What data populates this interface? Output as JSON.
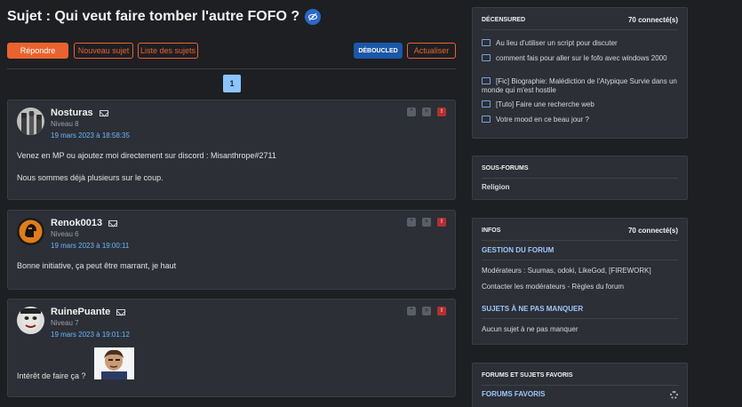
{
  "thread": {
    "title": "Sujet : Qui veut faire tomber l'autre FOFO ?",
    "page": "1"
  },
  "toolbar": {
    "reply": "Répondre",
    "new_topic": "Nouveau sujet",
    "topic_list": "Liste des sujets",
    "deboucled": "DÉBOUCLED",
    "refresh": "Actualiser"
  },
  "posts": [
    {
      "author": "Nosturas",
      "level": "Niveau 8",
      "date": "19 mars 2023 à 18:58:35",
      "line1": "Venez en MP ou ajoutez moi directement sur discord : Misanthrope#2711",
      "line2": "Nous sommes déjà plusieurs sur le coup."
    },
    {
      "author": "Renok0013",
      "level": "Niveau 6",
      "date": "19 mars 2023 à 19:00:11",
      "line1": "Bonne initiative, ça peut être marrant, je haut"
    },
    {
      "author": "RuinePuante",
      "level": "Niveau 7",
      "date": "19 mars 2023 à 19:01:12",
      "line1": "Intérêt de faire ça ?"
    }
  ],
  "sidebar": {
    "decensured": {
      "title": "DÉCENSURED",
      "count": "70 connecté(s)",
      "topics": [
        "Au lieu d'utiliser un script pour discuter",
        "comment fais pour aller sur le fofo avec windows 2000",
        "[Fic] Biographie: Malédiction de l'Atypique Survie dans un monde qui m'est hostile",
        "[Tuto] Faire une recherche web",
        "Votre mood en ce beau jour ?"
      ]
    },
    "subforums": {
      "title": "SOUS-FORUMS",
      "item": "Religion"
    },
    "infos": {
      "title": "INFOS",
      "count": "70 connecté(s)",
      "management": "GESTION DU FORUM",
      "moderators": "Modérateurs : Suumas, odoki, LikeGod, [FIREWORK]",
      "contact": "Contacter les modérateurs - Règles du forum",
      "must_see": "SUJETS À NE PAS MANQUER",
      "none": "Aucun sujet à ne pas manquer"
    },
    "favorites": {
      "title": "FORUMS ET SUJETS FAVORIS",
      "forums": "FORUMS FAVORIS"
    }
  }
}
